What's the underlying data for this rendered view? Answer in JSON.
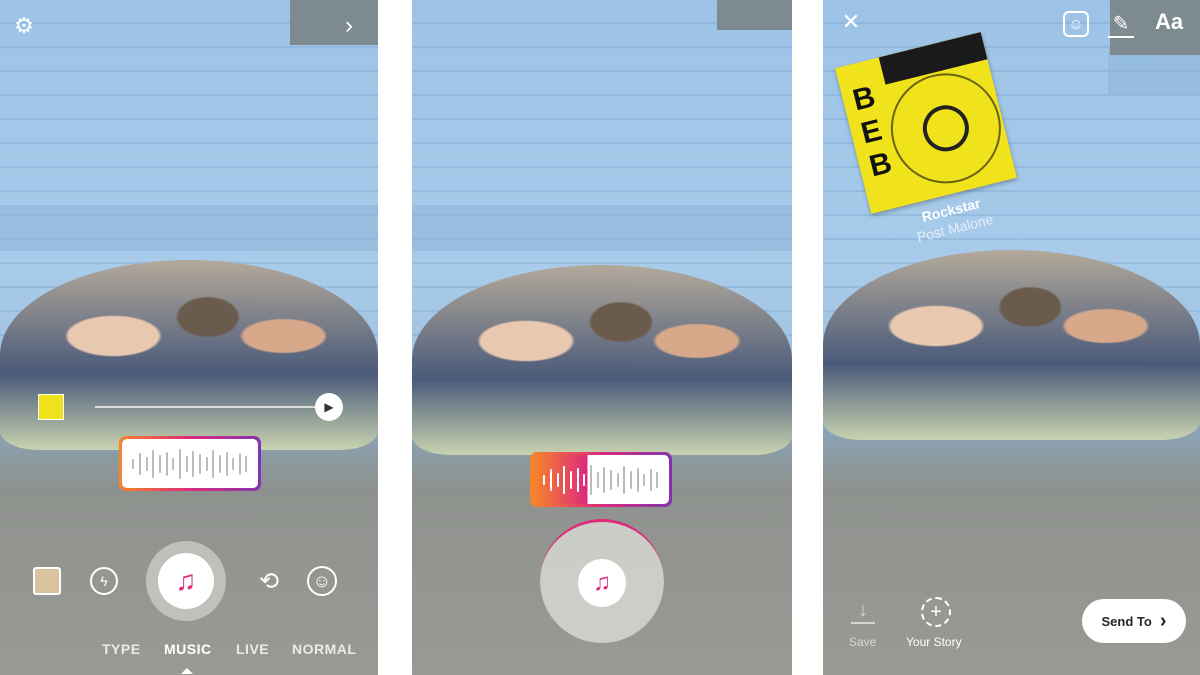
{
  "panel1": {
    "icons": [
      "gear-icon",
      "chevron-right-icon",
      "album-thumbnail",
      "play-icon",
      "gallery-thumbnail",
      "flash-icon",
      "music-note-icon",
      "flip-camera-icon",
      "face-effects-icon"
    ],
    "modes": [
      {
        "label": "TYPE",
        "active": false
      },
      {
        "label": "MUSIC",
        "active": true
      },
      {
        "label": "LIVE",
        "active": false
      },
      {
        "label": "NORMAL",
        "active": false
      }
    ]
  },
  "panel2": {
    "icons": [
      "music-note-icon"
    ],
    "progress_fill_percent": 40
  },
  "panel3": {
    "toolbar": {
      "close": "close-icon",
      "sticker": "sticker-icon",
      "draw": "pen-icon",
      "text_label": "Aa"
    },
    "sticker": {
      "song": "Rockstar",
      "artist": "Post Malone"
    },
    "save_label": "Save",
    "story_label": "Your Story",
    "send_label": "Send To"
  },
  "colors": {
    "gradient_start": "#f58529",
    "gradient_mid": "#dd2a7b",
    "gradient_end": "#8134af",
    "album_yellow": "#f0e31c"
  }
}
